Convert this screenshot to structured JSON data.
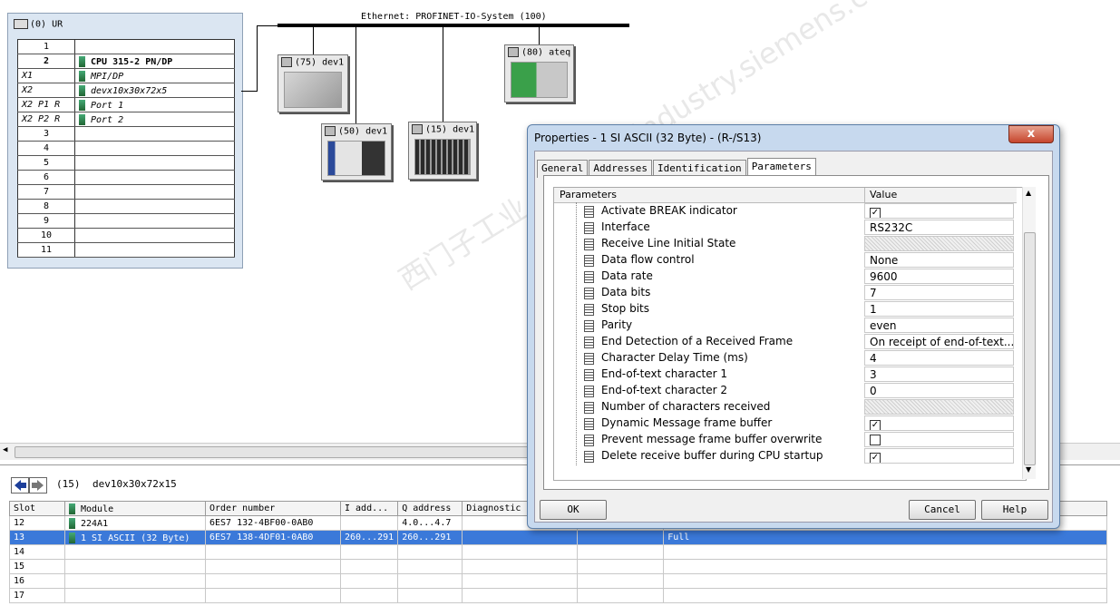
{
  "rack": {
    "title": "(0) UR",
    "rows": [
      {
        "slot": "1",
        "module": ""
      },
      {
        "slot": "2",
        "module": "CPU 315-2 PN/DP"
      },
      {
        "slot": "X1",
        "module": "MPI/DP"
      },
      {
        "slot": "X2",
        "module": "devx10x30x72x5"
      },
      {
        "slot": "X2 P1 R",
        "module": "Port 1"
      },
      {
        "slot": "X2 P2 R",
        "module": "Port 2"
      },
      {
        "slot": "3",
        "module": ""
      },
      {
        "slot": "4",
        "module": ""
      },
      {
        "slot": "5",
        "module": ""
      },
      {
        "slot": "6",
        "module": ""
      },
      {
        "slot": "7",
        "module": ""
      },
      {
        "slot": "8",
        "module": ""
      },
      {
        "slot": "9",
        "module": ""
      },
      {
        "slot": "10",
        "module": ""
      },
      {
        "slot": "11",
        "module": ""
      }
    ]
  },
  "network": {
    "label": "Ethernet: PROFINET-IO-System (100)",
    "devices": {
      "d75": "(75) dev1",
      "d50": "(50) dev1",
      "d15": "(15) dev1",
      "d80": "(80) ateq"
    }
  },
  "detail": {
    "station": "(15)",
    "device_name": "dev10x30x72x15",
    "columns": {
      "slot": "Slot",
      "module": "Module",
      "order": "Order number",
      "i_addr": "I add...",
      "q_addr": "Q address",
      "diag": "Diagnostic"
    },
    "rows": [
      {
        "slot": "12",
        "module": "224A1",
        "order": "6ES7 132-4BF00-0AB0",
        "i": "",
        "q": "4.0...4.7",
        "extra": ""
      },
      {
        "slot": "13",
        "module": "1 SI ASCII (32 Byte)",
        "order": "6ES7 138-4DF01-0AB0",
        "i": "260...291",
        "q": "260...291",
        "extra": "Full"
      },
      {
        "slot": "14",
        "module": "",
        "order": "",
        "i": "",
        "q": "",
        "extra": ""
      },
      {
        "slot": "15",
        "module": "",
        "order": "",
        "i": "",
        "q": "",
        "extra": ""
      },
      {
        "slot": "16",
        "module": "",
        "order": "",
        "i": "",
        "q": "",
        "extra": ""
      },
      {
        "slot": "17",
        "module": "",
        "order": "",
        "i": "",
        "q": "",
        "extra": ""
      }
    ]
  },
  "dialog": {
    "title": "Properties - 1 SI ASCII (32 Byte) - (R-/S13)",
    "close": "x",
    "tabs": [
      "General",
      "Addresses",
      "Identification",
      "Parameters"
    ],
    "grid_head": {
      "name": "Parameters",
      "value": "Value"
    },
    "params": [
      {
        "name": "Activate BREAK indicator",
        "value": "",
        "checked": true
      },
      {
        "name": "Interface",
        "value": "RS232C"
      },
      {
        "name": "Receive Line Initial State",
        "value": "",
        "hatch": true
      },
      {
        "name": "Data flow control",
        "value": "None"
      },
      {
        "name": "Data rate",
        "value": "9600"
      },
      {
        "name": "Data bits",
        "value": "7"
      },
      {
        "name": "Stop bits",
        "value": "1"
      },
      {
        "name": "Parity",
        "value": "even"
      },
      {
        "name": "End Detection of a Received Frame",
        "value": "On receipt of end-of-text..."
      },
      {
        "name": "Character Delay Time (ms)",
        "value": "4"
      },
      {
        "name": "End-of-text character 1",
        "value": "3"
      },
      {
        "name": "End-of-text character 2",
        "value": "0"
      },
      {
        "name": "Number of characters received",
        "value": "",
        "hatch": true
      },
      {
        "name": "Dynamic Message frame buffer",
        "value": "",
        "checked": true
      },
      {
        "name": "Prevent message frame buffer overwrite",
        "value": "",
        "checked": false
      },
      {
        "name": "Delete receive buffer during CPU startup",
        "value": "",
        "checked": true
      }
    ],
    "ok": "OK",
    "cancel": "Cancel",
    "help": "Help"
  },
  "watermark": "西门子工业 support.industry.siemens.com"
}
